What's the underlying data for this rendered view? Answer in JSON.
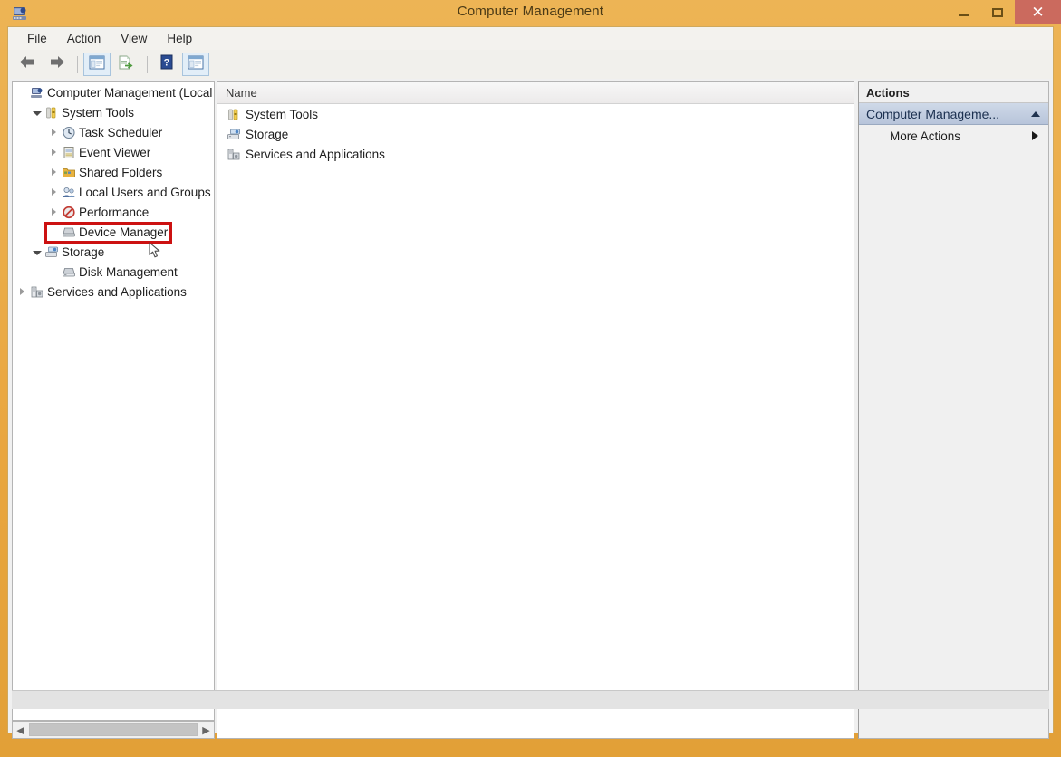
{
  "window": {
    "title": "Computer Management",
    "app_icon": "computer-management-icon",
    "frame_color": "#e8a33d",
    "controls": {
      "minimize": "minimize-icon",
      "maximize": "maximize-icon",
      "close": "close-icon",
      "close_color": "#cb6a5e"
    }
  },
  "menubar": {
    "items": [
      {
        "label": "File"
      },
      {
        "label": "Action"
      },
      {
        "label": "View"
      },
      {
        "label": "Help"
      }
    ]
  },
  "toolbar": {
    "buttons": [
      {
        "name": "back-button",
        "icon": "left-arrow-icon",
        "framed": false
      },
      {
        "name": "forward-button",
        "icon": "right-arrow-icon",
        "framed": false
      },
      {
        "name": "show-console-tree-button",
        "icon": "console-tree-icon",
        "framed": true
      },
      {
        "name": "export-list-button",
        "icon": "export-list-icon",
        "framed": false
      },
      {
        "name": "help-button",
        "icon": "question-mark-icon",
        "framed": false
      },
      {
        "name": "show-action-pane-button",
        "icon": "action-pane-icon",
        "framed": true
      }
    ]
  },
  "tree": {
    "nodes": [
      {
        "label": "Computer Management (Local",
        "depth": 0,
        "twisty": "none",
        "icon": "computer-icon"
      },
      {
        "label": "System Tools",
        "depth": 1,
        "twisty": "expanded",
        "icon": "system-tools-icon"
      },
      {
        "label": "Task Scheduler",
        "depth": 2,
        "twisty": "collapsed",
        "icon": "clock-icon"
      },
      {
        "label": "Event Viewer",
        "depth": 2,
        "twisty": "collapsed",
        "icon": "event-viewer-icon"
      },
      {
        "label": "Shared Folders",
        "depth": 2,
        "twisty": "collapsed",
        "icon": "shared-folders-icon"
      },
      {
        "label": "Local Users and Groups",
        "depth": 2,
        "twisty": "collapsed",
        "icon": "users-icon"
      },
      {
        "label": "Performance",
        "depth": 2,
        "twisty": "collapsed",
        "icon": "performance-icon"
      },
      {
        "label": "Device Manager",
        "depth": 2,
        "twisty": "none",
        "icon": "device-manager-icon"
      },
      {
        "label": "Storage",
        "depth": 1,
        "twisty": "expanded",
        "icon": "storage-icon"
      },
      {
        "label": "Disk Management",
        "depth": 2,
        "twisty": "none",
        "icon": "disk-management-icon"
      },
      {
        "label": "Services and Applications",
        "depth": 1,
        "twisty": "collapsed",
        "icon": "services-icon"
      }
    ],
    "scrollbar": {
      "left_arrow": "scroll-left-icon",
      "right_arrow": "scroll-right-icon"
    }
  },
  "center": {
    "column_header": "Name",
    "rows": [
      {
        "label": "System Tools",
        "icon": "system-tools-icon"
      },
      {
        "label": "Storage",
        "icon": "storage-icon"
      },
      {
        "label": "Services and Applications",
        "icon": "services-icon"
      }
    ]
  },
  "actions": {
    "title": "Actions",
    "group_label": "Computer Manageme...",
    "group_chevron": "chevron-up-icon",
    "more_actions_label": "More Actions",
    "more_actions_chevron": "chevron-right-icon"
  },
  "annotation": {
    "target": "Device Manager",
    "color": "#cc1111"
  }
}
